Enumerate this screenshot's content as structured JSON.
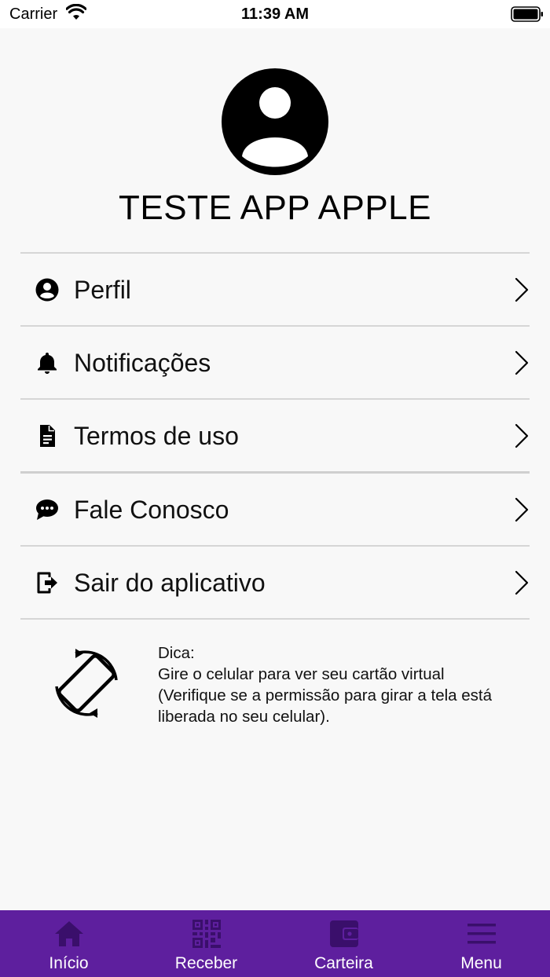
{
  "status_bar": {
    "carrier": "Carrier",
    "time": "11:39 AM",
    "wifi_icon": "wifi-icon",
    "battery_icon": "battery-icon"
  },
  "profile": {
    "avatar_icon": "user-circle-icon",
    "name": "TESTE APP APPLE"
  },
  "menu": {
    "items": [
      {
        "label": "Perfil",
        "icon": "account-circle-icon"
      },
      {
        "label": "Notificações",
        "icon": "bell-icon"
      },
      {
        "label": "Termos de uso",
        "icon": "document-icon"
      },
      {
        "label": "Fale Conosco",
        "icon": "chat-bubble-icon"
      },
      {
        "label": "Sair do aplicativo",
        "icon": "logout-icon"
      }
    ],
    "chevron_icon": "chevron-right-icon"
  },
  "tip": {
    "icon": "screen-rotation-icon",
    "title": "Dica:",
    "lines": [
      "Gire o celular para ver seu cartão virtual",
      "(Verifique se a permissão para girar a tela está",
      "liberada no seu celular)."
    ]
  },
  "tab_bar": {
    "background": "#5e1f9e",
    "items": [
      {
        "label": "Início",
        "icon": "home-icon"
      },
      {
        "label": "Receber",
        "icon": "qr-code-icon"
      },
      {
        "label": "Carteira",
        "icon": "wallet-icon"
      },
      {
        "label": "Menu",
        "icon": "hamburger-menu-icon"
      }
    ]
  }
}
